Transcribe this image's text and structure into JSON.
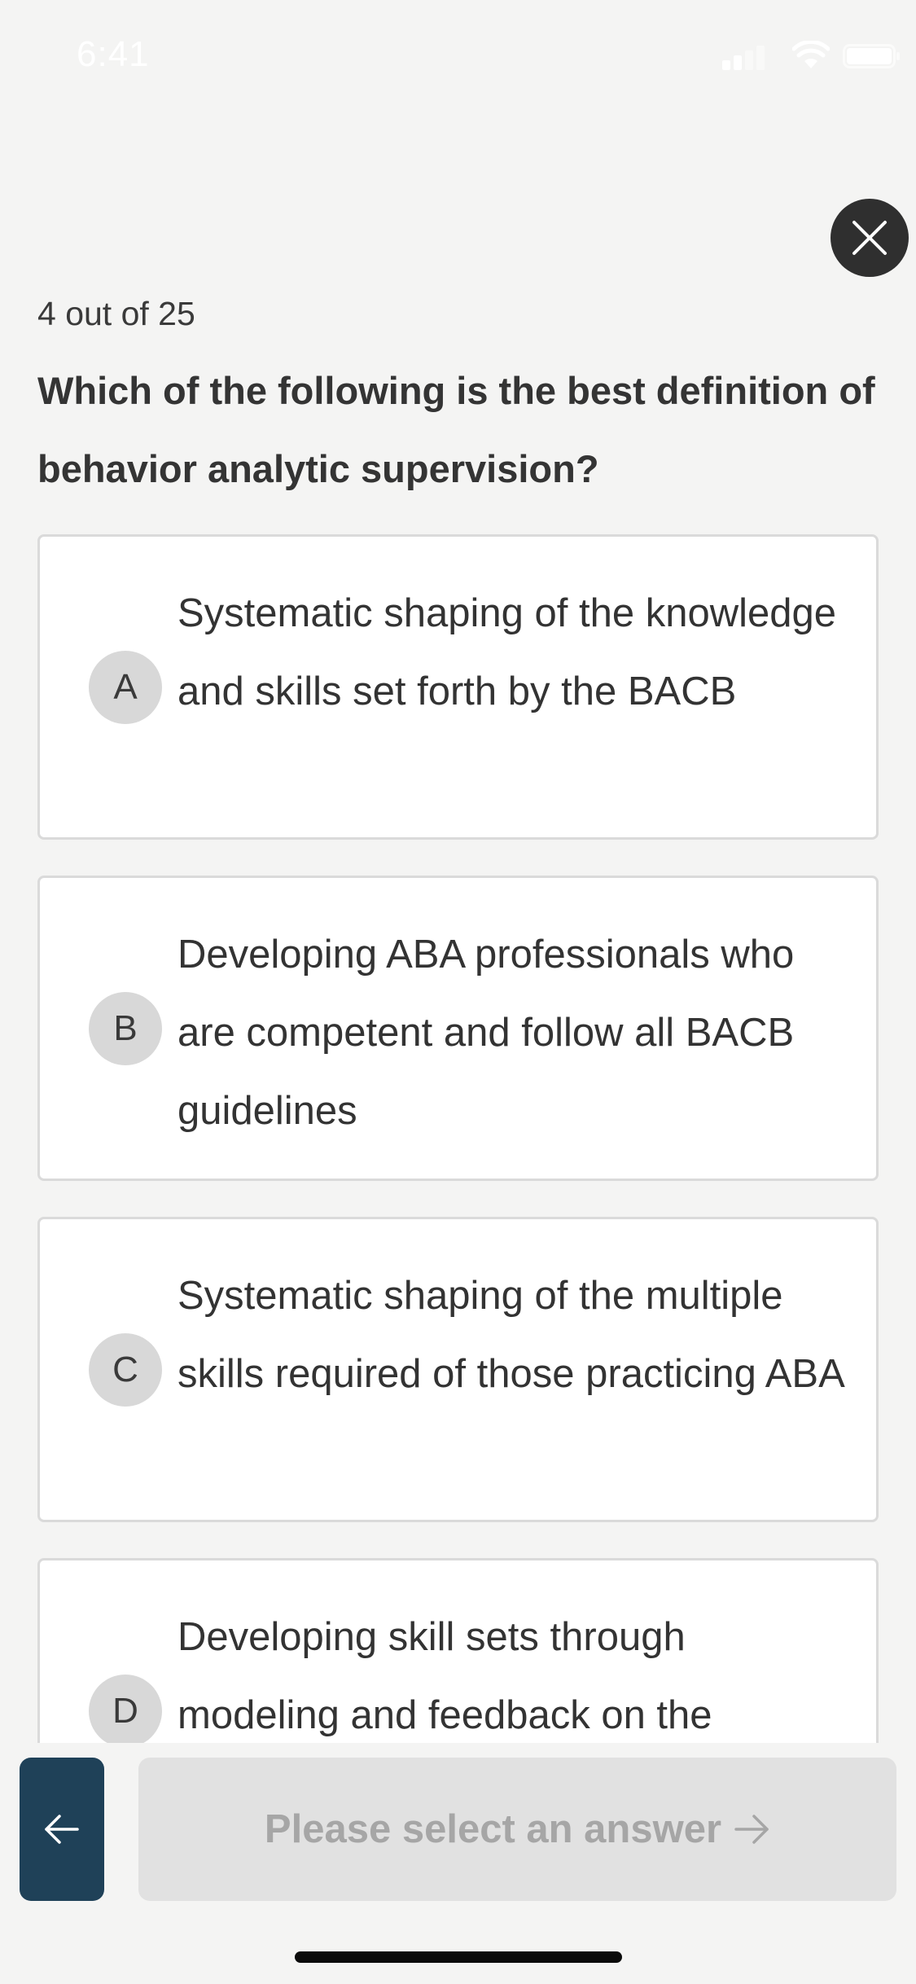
{
  "status_bar": {
    "time": "6:41",
    "icons": [
      "cellular-signal-icon",
      "wifi-icon",
      "battery-icon"
    ]
  },
  "header": {
    "close_icon": "close-icon"
  },
  "quiz": {
    "progress": "4 out of 25",
    "question": "Which of the following is the best definition of behavior analytic supervision?",
    "options": [
      {
        "letter": "A",
        "text": "Systematic shaping of the knowledge and skills set forth by the BACB"
      },
      {
        "letter": "B",
        "text": "Developing ABA professionals who are competent and follow all BACB guidelines"
      },
      {
        "letter": "C",
        "text": "Systematic shaping of the multiple skills required of those practicing ABA"
      },
      {
        "letter": "D",
        "text": "Developing skill sets through modeling and feedback on the"
      }
    ]
  },
  "footer": {
    "back_icon": "arrow-left-icon",
    "next_label": "Please select an answer",
    "next_icon": "arrow-right-icon"
  },
  "colors": {
    "background": "#f4f4f3",
    "close_button": "#2f2f2f",
    "back_button": "#1f4158",
    "disabled_button": "#e1e1e1",
    "disabled_text": "#a6a6a6",
    "letter_badge": "#d8d8d8"
  }
}
